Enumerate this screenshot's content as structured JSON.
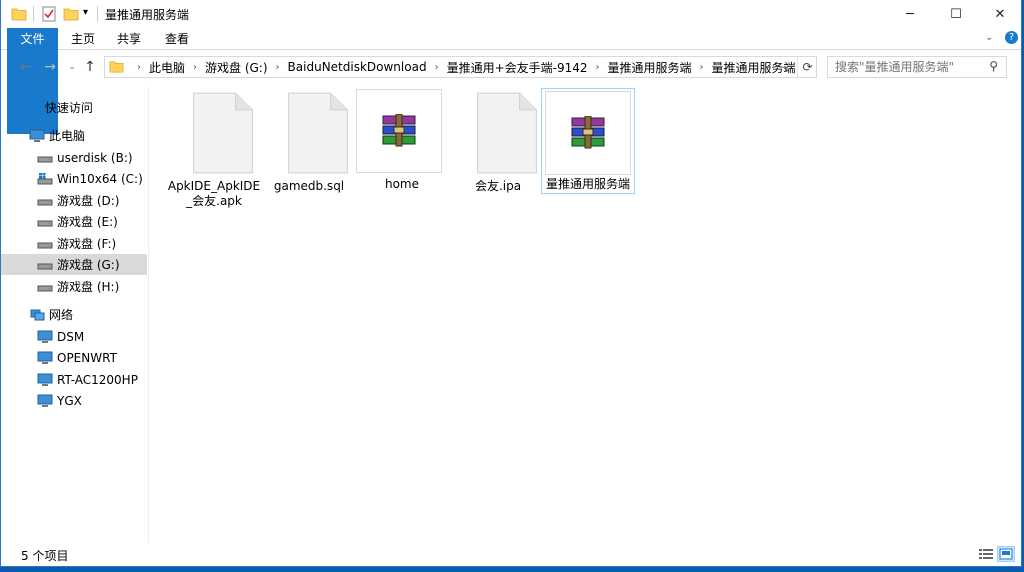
{
  "window": {
    "title": "量推通用服务端",
    "minimize": "─",
    "maximize": "☐",
    "close": "✕"
  },
  "ribbon": {
    "tabs": [
      "文件",
      "主页",
      "共享",
      "查看"
    ]
  },
  "address": {
    "crumbs": [
      "此电脑",
      "游戏盘 (G:)",
      "BaiduNetdiskDownload",
      "量推通用+会友手端-9142",
      "量推通用服务端",
      "量推通用服务端"
    ]
  },
  "search": {
    "placeholder": "搜索\"量推通用服务端\""
  },
  "sidebar": {
    "items": [
      {
        "label": "快速访问",
        "icon": "star-icon"
      },
      {
        "label": "此电脑",
        "icon": "computer-icon"
      },
      {
        "label": "userdisk (B:)",
        "icon": "drive-icon"
      },
      {
        "label": "Win10x64 (C:)",
        "icon": "windows-drive-icon"
      },
      {
        "label": "游戏盘 (D:)",
        "icon": "drive-icon"
      },
      {
        "label": "游戏盘 (E:)",
        "icon": "drive-icon"
      },
      {
        "label": "游戏盘 (F:)",
        "icon": "drive-icon"
      },
      {
        "label": "游戏盘 (G:)",
        "icon": "drive-icon"
      },
      {
        "label": "游戏盘 (H:)",
        "icon": "drive-icon"
      },
      {
        "label": "网络",
        "icon": "network-icon"
      },
      {
        "label": "DSM",
        "icon": "monitor-icon"
      },
      {
        "label": "OPENWRT",
        "icon": "monitor-icon"
      },
      {
        "label": "RT-AC1200HP",
        "icon": "monitor-icon"
      },
      {
        "label": "YGX",
        "icon": "monitor-icon"
      }
    ]
  },
  "files": [
    {
      "name": "ApkIDE_ApkIDE_会友.apk",
      "line1": "ApkIDE_ApkIDE",
      "line2": "_会友.apk",
      "icon": "blank-file-icon"
    },
    {
      "name": "gamedb.sql",
      "line1": "gamedb.sql",
      "line2": "",
      "icon": "blank-file-icon"
    },
    {
      "name": "home",
      "line1": "home",
      "line2": "",
      "icon": "winrar-archive-icon"
    },
    {
      "name": "会友.ipa",
      "line1": "会友.ipa",
      "line2": "",
      "icon": "blank-file-icon"
    },
    {
      "name": "量推通用服务端",
      "line1": "量推通用服务端",
      "line2": "",
      "icon": "winrar-archive-icon"
    }
  ],
  "status": {
    "count": "5 个项目"
  },
  "colors": {
    "accent": "#1979ca",
    "selection": "#cce8ff",
    "selection_border": "#99d1ff"
  }
}
